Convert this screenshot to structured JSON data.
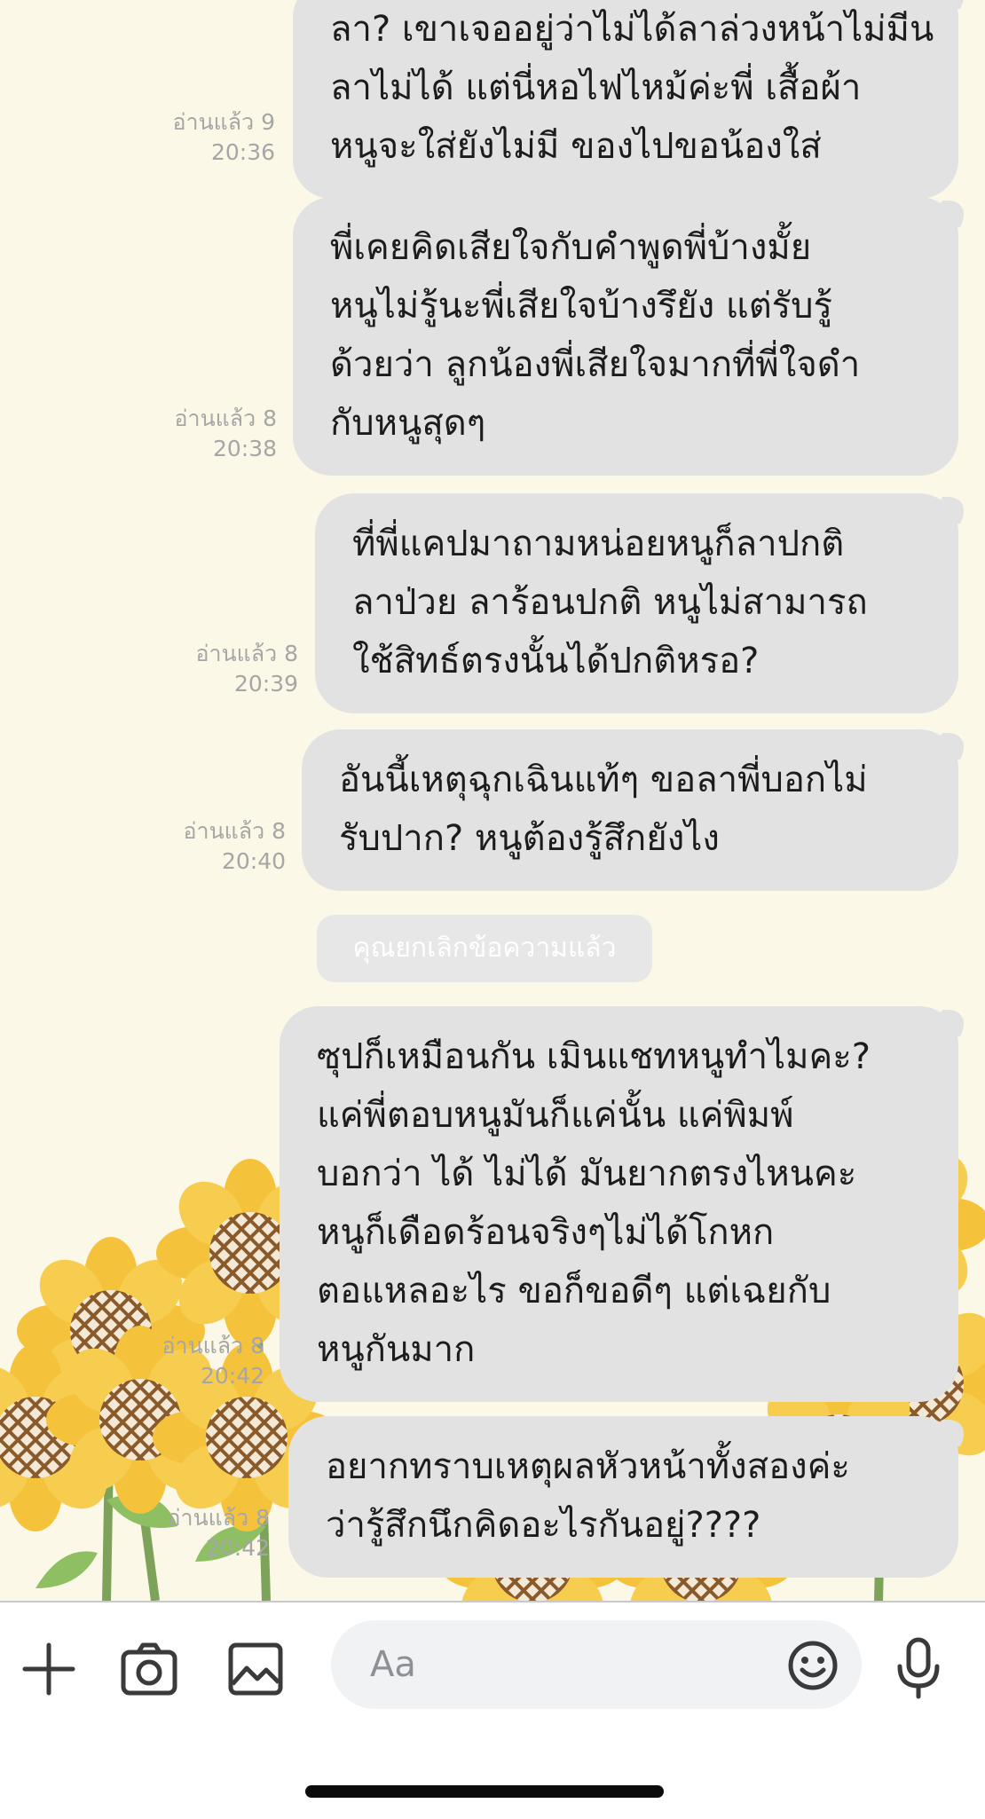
{
  "theme": {
    "background": "#fbf8e8",
    "bubble_color": "#e2e2e2",
    "read_text_color": "#a6a6a6",
    "petal_color": "#f5c33b",
    "seed_color": "#8a5a2b"
  },
  "messages": [
    {
      "lines": [
        "ลา? เขาเจออยู่ว่าไม่ได้ลาล่วงหน้าไม่มีน",
        "ลาไม่ได้ แต่นี่หอไฟไหม้ค่ะพี่ เสื้อผ้า",
        "หนูจะใส่ยังไม่มี ของไปขอน้องใส่"
      ],
      "read": "อ่านแล้ว 9",
      "time": "20:36"
    },
    {
      "lines": [
        "พี่เคยคิดเสียใจกับคำพูดพี่บ้างมั้ย",
        "หนูไม่รู้นะพี่เสียใจบ้างรึยัง แต่รับรู้",
        "ด้วยว่า ลูกน้องพี่เสียใจมากที่พี่ใจดำ",
        "กับหนูสุดๆ"
      ],
      "read": "อ่านแล้ว 8",
      "time": "20:38"
    },
    {
      "lines": [
        "ที่พี่แคปมาถามหน่อยหนูก็ลาปกติ",
        "ลาป่วย ลาร้อนปกติ หนูไม่สามารถ",
        "ใช้สิทธ์ตรงนั้นได้ปกติหรอ?"
      ],
      "read": "อ่านแล้ว 8",
      "time": "20:39"
    },
    {
      "lines": [
        "อันนี้เหตุฉุกเฉินแท้ๆ ขอลาพี่บอกไม่",
        "รับปาก? หนูต้องรู้สึกยังไง"
      ],
      "read": "อ่านแล้ว 8",
      "time": "20:40"
    },
    {
      "lines": [
        "ซุปก็เหมือนกัน เมินแชทหนูทำไมคะ?",
        "แค่พี่ตอบหนูมันก็แค่นั้น แค่พิมพ์",
        "บอกว่า ได้ ไม่ได้ มันยากตรงไหนคะ",
        "หนูก็เดือดร้อนจริงๆไม่ได้โกหก",
        "ตอแหลอะไร ขอก็ขอดีๆ แต่เฉยกับ",
        "หนูกันมาก"
      ],
      "read": "อ่านแล้ว 8",
      "time": "20:42"
    },
    {
      "lines": [
        "อยากทราบเหตุผลหัวหน้าทั้งสองค่ะ",
        "ว่ารู้สึกนึกคิดอะไรกันอยู่????"
      ],
      "read": "อ่านแล้ว 8",
      "time": "20:42"
    }
  ],
  "system_notice": "คุณยกเลิกข้อความแล้ว",
  "composer": {
    "placeholder": "Aa",
    "icons": [
      "plus-icon",
      "camera-icon",
      "image-icon",
      "emoji-icon",
      "microphone-icon"
    ]
  }
}
